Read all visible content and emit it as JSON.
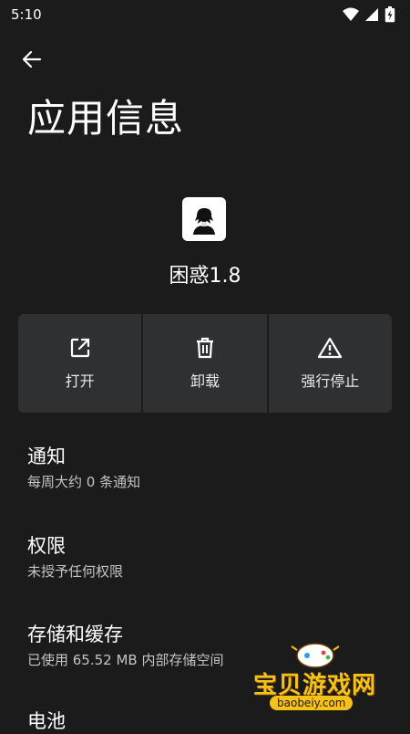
{
  "status_bar": {
    "time": "5:10"
  },
  "header": {
    "title": "应用信息"
  },
  "app": {
    "name": "困惑1.8"
  },
  "actions": [
    {
      "label": "打开",
      "icon": "open-external-icon"
    },
    {
      "label": "卸载",
      "icon": "trash-icon"
    },
    {
      "label": "强行停止",
      "icon": "warning-icon"
    }
  ],
  "settings": [
    {
      "title": "通知",
      "subtitle": "每周大约 0 条通知"
    },
    {
      "title": "权限",
      "subtitle": "未授予任何权限"
    },
    {
      "title": "存储和缓存",
      "subtitle": "已使用 65.52 MB 内部存储空间"
    },
    {
      "title": "电池",
      "subtitle": ""
    }
  ],
  "watermark": {
    "text": "宝贝游戏网",
    "url": "baobeiy.com"
  },
  "colors": {
    "background": "#1b1b1b",
    "button_bg": "#2f3032",
    "watermark": "#f5c21a"
  }
}
